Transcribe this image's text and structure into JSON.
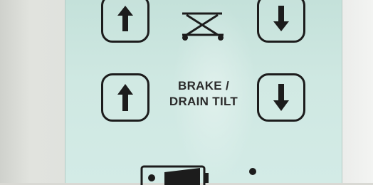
{
  "control_panel": {
    "brake_label_line1": "BRAKE /",
    "brake_label_line2": "DRAIN TILT"
  },
  "icons": {
    "top_left_button": "arrow-up-icon",
    "top_right_button": "arrow-down-icon",
    "top_center": "bed-tilt-icon",
    "brake_left_button": "arrow-up-icon",
    "brake_right_button": "arrow-down-icon",
    "bottom_left": "battery-icon",
    "bottom_center": "indicator-led"
  },
  "colors": {
    "panel": "#cfe8e2",
    "ink": "#1c1c1c"
  }
}
